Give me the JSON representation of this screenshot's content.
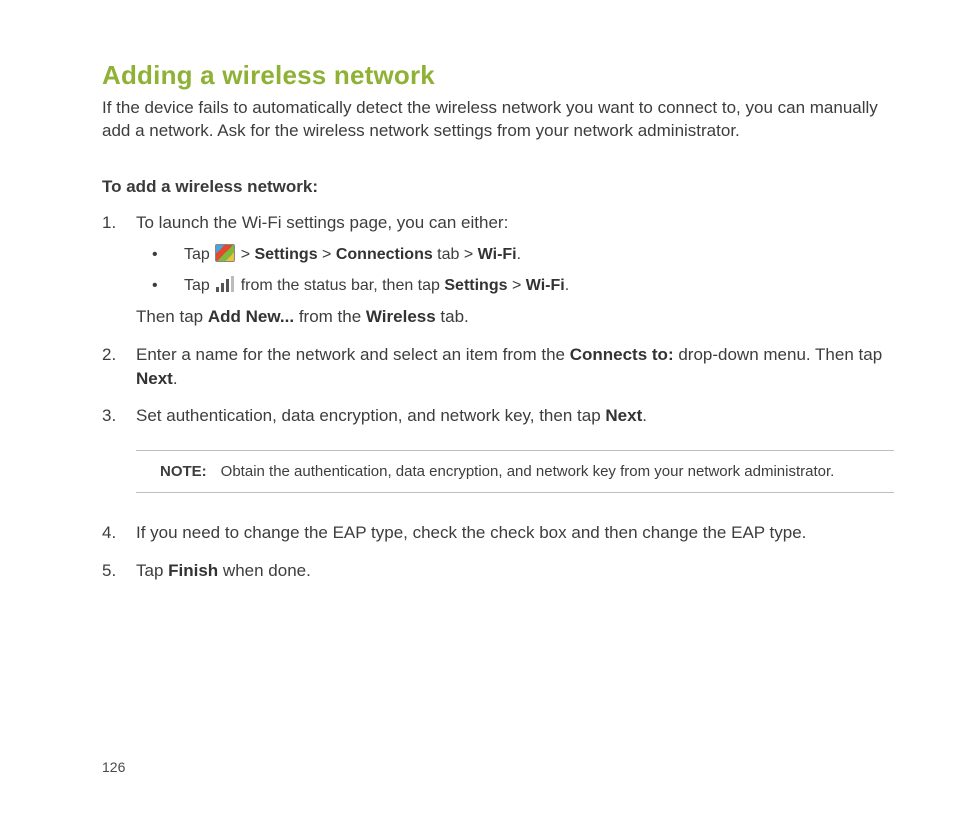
{
  "title": "Adding a wireless network",
  "intro": "If the device fails to automatically detect the wireless network you want to connect to, you can manually add a network. Ask for the wireless network settings from your network administrator.",
  "subhead": "To add a wireless network:",
  "step1": {
    "lead": "To launch the Wi-Fi settings page, you can either:",
    "bullet_a": {
      "pre": "Tap ",
      "gt1": " > ",
      "settings": "Settings",
      "gt2": " > ",
      "connections": "Connections",
      "tab": " tab > ",
      "wifi": "Wi-Fi",
      "dot": "."
    },
    "bullet_b": {
      "pre": "Tap ",
      "mid": " from the status bar, then tap ",
      "settings": "Settings",
      "gt": " > ",
      "wifi": "Wi-Fi",
      "dot": "."
    },
    "then": {
      "pre": "Then tap ",
      "addnew": "Add New...",
      "mid": " from the ",
      "wireless": "Wireless",
      "post": " tab."
    }
  },
  "step2": {
    "pre": "Enter a name for the network and select an item from the ",
    "connects": "Connects to:",
    "mid": " drop-down menu. Then tap ",
    "next": "Next",
    "dot": "."
  },
  "step3": {
    "pre": "Set authentication, data encryption, and network key, then tap ",
    "next": "Next",
    "dot": "."
  },
  "note": {
    "label": "NOTE:",
    "text": "Obtain the authentication, data encryption, and network key from your network administrator."
  },
  "step4": "If you need to change the EAP type, check the check box and then change the EAP type.",
  "step5": {
    "pre": "Tap ",
    "finish": "Finish",
    "post": " when done."
  },
  "page_number": "126"
}
